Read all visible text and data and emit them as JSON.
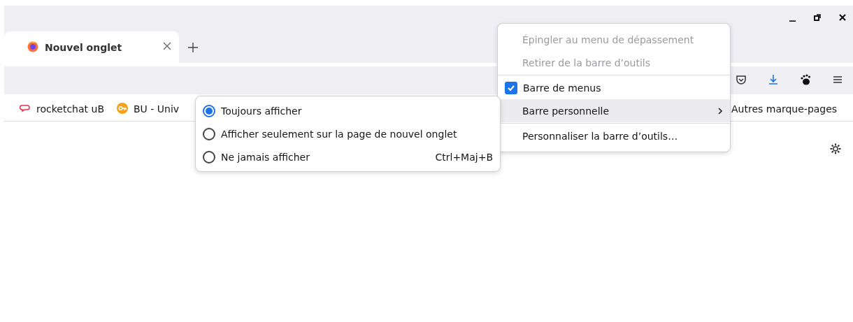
{
  "tabs": [
    {
      "label": "Nouvel onglet",
      "selected": true
    }
  ],
  "bookmarks": [
    {
      "label": "rocketchat uB"
    },
    {
      "label": "BU - Univ"
    }
  ],
  "other_bookmarks": "Autres marque-pages",
  "context_menu": [
    {
      "kind": "item",
      "label": "Épingler au menu de dépassement",
      "disabled": true
    },
    {
      "kind": "item",
      "label": "Retirer de la barre d’outils",
      "disabled": true
    },
    {
      "kind": "separator"
    },
    {
      "kind": "check",
      "label": "Barre de menus",
      "checked": true
    },
    {
      "kind": "submenu",
      "label": "Barre personnelle",
      "expanded": true
    },
    {
      "kind": "separator"
    },
    {
      "kind": "item",
      "label": "Personnaliser la barre d’outils…",
      "disabled": false
    }
  ],
  "submenu": [
    {
      "label": "Toujours afficher",
      "selected": true
    },
    {
      "label": "Afficher seulement sur la page de nouvel onglet",
      "selected": false
    },
    {
      "label": "Ne jamais afficher",
      "selected": false,
      "shortcut": "Ctrl+Maj+B"
    }
  ]
}
